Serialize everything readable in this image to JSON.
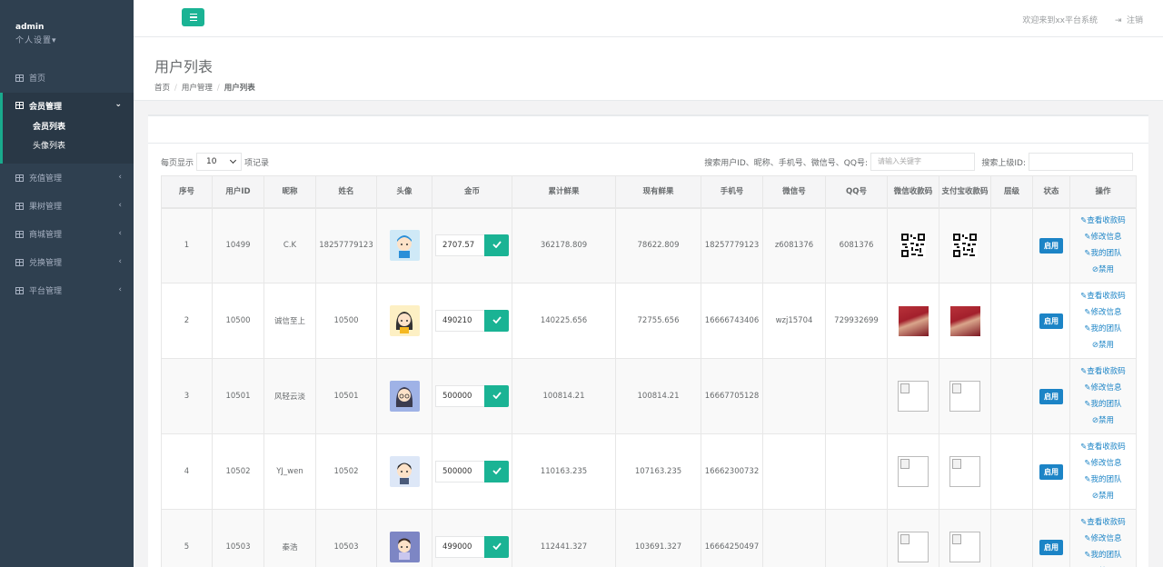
{
  "sidebar": {
    "user": "admin",
    "settings": "个人设置▾",
    "home": "首页",
    "member_group": "会员管理",
    "member_subs": [
      "会员列表",
      "头像列表"
    ],
    "groups": [
      "充值管理",
      "果树管理",
      "商城管理",
      "兑换管理",
      "平台管理"
    ]
  },
  "topbar": {
    "welcome": "欢迎来到xx平台系统",
    "logout": "注销"
  },
  "heading": {
    "title": "用户列表",
    "crumbs": [
      "首页",
      "用户管理",
      "用户列表"
    ]
  },
  "controls": {
    "per_page_prefix": "每页显示",
    "per_page_value": "10",
    "per_page_suffix": "项记录",
    "search_label": "搜索用户ID、昵称、手机号、微信号、QQ号:",
    "search_placeholder": "请输入关键字",
    "search_parent_label": "搜索上级ID:"
  },
  "table": {
    "headers": [
      "序号",
      "用户ID",
      "昵称",
      "姓名",
      "头像",
      "金币",
      "累计鲜果",
      "现有鲜果",
      "手机号",
      "微信号",
      "QQ号",
      "微信收款码",
      "支付宝收款码",
      "层级",
      "状态",
      "操作"
    ],
    "status_label": "启用",
    "op_labels": [
      "查看收款码",
      "修改信息",
      "我的团队",
      "禁用"
    ],
    "rows": [
      {
        "no": "1",
        "uid": "10499",
        "nick": "C.K",
        "name": "18257779123",
        "coin": "2707.57",
        "total": "362178.809",
        "current": "78622.809",
        "phone": "18257779123",
        "wechat": "z6081376",
        "qq": "6081376",
        "wxqr": "qr",
        "aliqr": "qr",
        "avatar": "boy-blue"
      },
      {
        "no": "2",
        "uid": "10500",
        "nick": "诚信至上",
        "name": "10500",
        "coin": "490210",
        "total": "140225.656",
        "current": "72755.656",
        "phone": "16666743406",
        "wechat": "wzj15704",
        "qq": "729932699",
        "wxqr": "photo",
        "aliqr": "photo",
        "avatar": "girl-yellow"
      },
      {
        "no": "3",
        "uid": "10501",
        "nick": "风轻云淡",
        "name": "10501",
        "coin": "500000",
        "total": "100814.21",
        "current": "100814.21",
        "phone": "16667705128",
        "wechat": "",
        "qq": "",
        "wxqr": "broken",
        "aliqr": "broken",
        "avatar": "girl-glasses"
      },
      {
        "no": "4",
        "uid": "10502",
        "nick": "YJ_wen",
        "name": "10502",
        "coin": "500000",
        "total": "110163.235",
        "current": "107163.235",
        "phone": "16662300732",
        "wechat": "",
        "qq": "",
        "wxqr": "broken",
        "aliqr": "broken",
        "avatar": "boy-black"
      },
      {
        "no": "5",
        "uid": "10503",
        "nick": "秦浩",
        "name": "10503",
        "coin": "499000",
        "total": "112441.327",
        "current": "103691.327",
        "phone": "16664250497",
        "wechat": "",
        "qq": "",
        "wxqr": "broken",
        "aliqr": "broken",
        "avatar": "boy-purple"
      }
    ]
  }
}
